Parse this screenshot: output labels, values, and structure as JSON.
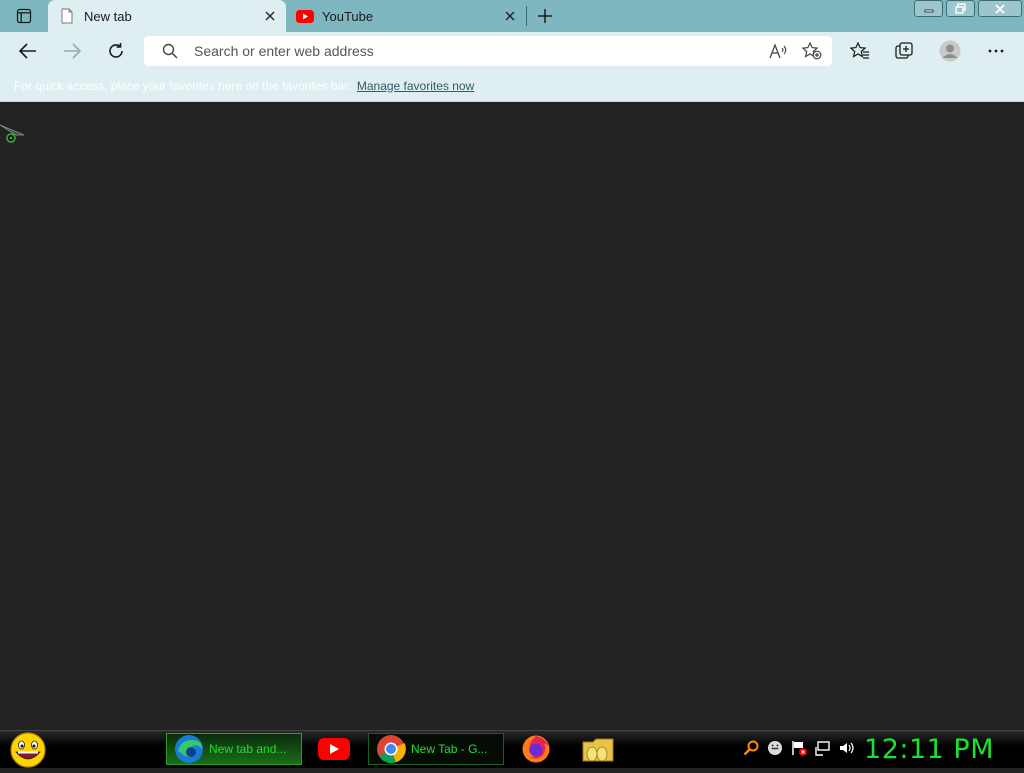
{
  "browser": {
    "tabs": [
      {
        "title": "New tab",
        "icon": "page-icon",
        "active": true
      },
      {
        "title": "YouTube",
        "icon": "youtube-icon",
        "active": false
      }
    ],
    "address_bar": {
      "placeholder": "Search or enter web address",
      "value": ""
    },
    "favorites_bar": {
      "message": "For quick access, place your favorites here on the favorites bar.",
      "link": "Manage favorites now"
    },
    "colors": {
      "chrome": "#7fb7c0",
      "toolbar": "#dfeef1",
      "page_background": "#232323"
    }
  },
  "taskbar": {
    "items": [
      {
        "label": "New tab and...",
        "icon": "edge-icon"
      },
      {
        "label": "",
        "icon": "youtube-icon"
      },
      {
        "label": "New Tab - G...",
        "icon": "chrome-icon"
      },
      {
        "label": "",
        "icon": "firefox-icon"
      },
      {
        "label": "",
        "icon": "folder-icon"
      }
    ],
    "clock": "12:11 PM",
    "accent": "#16e52d"
  }
}
